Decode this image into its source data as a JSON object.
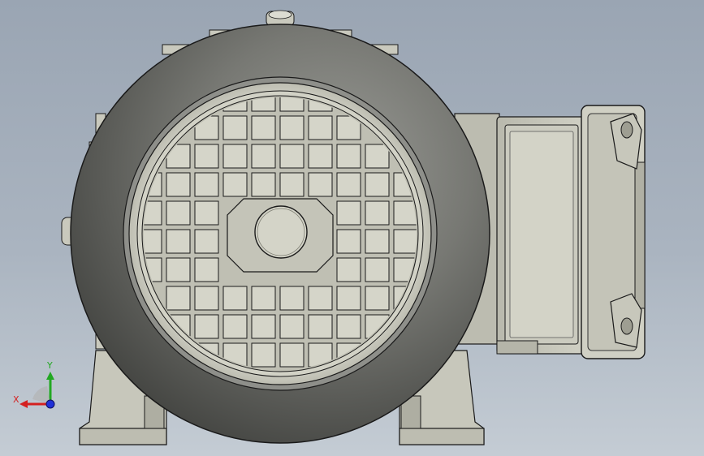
{
  "viewport": {
    "name": "3d-model-viewport",
    "background_top": "#9aa5b3",
    "background_bottom": "#c4ccd4"
  },
  "model": {
    "name": "electric-motor-end-view",
    "body_color": "#6f706c",
    "part_color": "#c9c9bd",
    "edge_color": "#1a1a1a"
  },
  "triad": {
    "x_label": "X",
    "y_label": "Y",
    "x_color": "#d42020",
    "y_color": "#22a822",
    "z_color": "#2030d8"
  }
}
